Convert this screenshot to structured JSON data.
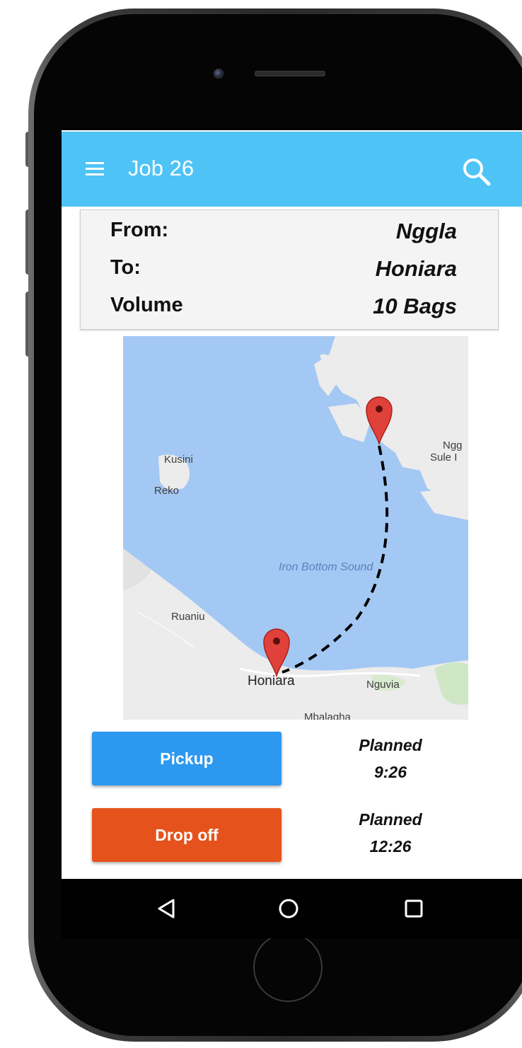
{
  "app": {
    "title": "Job 26"
  },
  "icons": {
    "menu": "hamburger-menu-icon",
    "search": "search-icon",
    "map_marker": "map-pin-icon",
    "nav_back": "triangle-back-icon",
    "nav_home": "circle-home-icon",
    "nav_recents": "square-recents-icon"
  },
  "job": {
    "rows": [
      {
        "label": "From:",
        "value": "Nggla"
      },
      {
        "label": "To:",
        "value": "Honiara"
      },
      {
        "label": "Volume",
        "value": "10 Bags"
      }
    ]
  },
  "map": {
    "labels": {
      "kusini": "Kusini",
      "reko": "Reko",
      "ngg": "Ngg",
      "sule": "Sule I",
      "sound": "Iron Bottom Sound",
      "ruaniu": "Ruaniu",
      "honiara": "Honiara",
      "nguvia": "Nguvia",
      "mbalagha": "Mbalagha"
    }
  },
  "actions": {
    "pickup": {
      "label": "Pickup",
      "status": "Planned",
      "time": "9:26"
    },
    "dropoff": {
      "label": "Drop off",
      "status": "Planned",
      "time": "12:26"
    }
  },
  "colors": {
    "appbar": "#4ec3f6",
    "pickup": "#2c98f0",
    "dropoff": "#e6521b",
    "water": "#a4c8f4",
    "land": "#ececec",
    "pin": "#e0413a"
  }
}
